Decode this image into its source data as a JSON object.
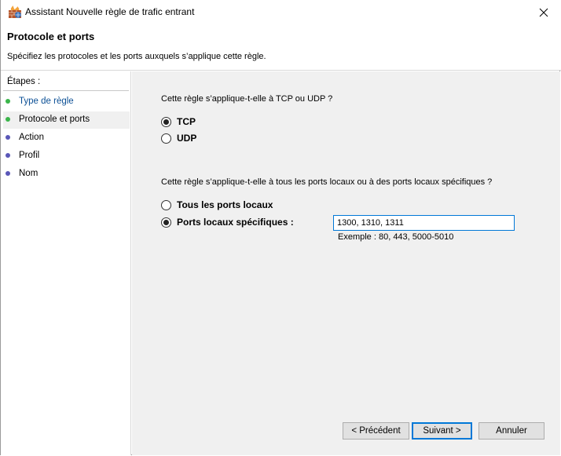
{
  "window": {
    "title": "Assistant Nouvelle règle de trafic entrant",
    "icon": "firewall-icon"
  },
  "header": {
    "title": "Protocole et ports",
    "description": "Spécifiez les protocoles et les ports auxquels s’applique cette règle."
  },
  "sidebar": {
    "steps_label": "Étapes :",
    "steps": [
      {
        "label": "Type de règle",
        "state": "done",
        "color": "#3ab54a",
        "text_color": "#0b4f95"
      },
      {
        "label": "Protocole et ports",
        "state": "current",
        "color": "#3ab54a",
        "text_color": "#000000"
      },
      {
        "label": "Action",
        "state": "pending",
        "color": "#5a57b8",
        "text_color": "#000000"
      },
      {
        "label": "Profil",
        "state": "pending",
        "color": "#5a57b8",
        "text_color": "#000000"
      },
      {
        "label": "Nom",
        "state": "pending",
        "color": "#5a57b8",
        "text_color": "#000000"
      }
    ]
  },
  "main": {
    "protocol_question": "Cette règle s’applique-t-elle à TCP ou UDP ?",
    "protocol_options": [
      {
        "label": "TCP",
        "selected": true
      },
      {
        "label": "UDP",
        "selected": false
      }
    ],
    "ports_question": "Cette règle s’applique-t-elle à tous les ports locaux ou à des ports locaux spécifiques ?",
    "ports_options": [
      {
        "label": "Tous les ports locaux",
        "selected": false
      },
      {
        "label": "Ports locaux spécifiques :",
        "selected": true
      }
    ],
    "ports_value": "1300, 1310, 1311",
    "example": "Exemple : 80, 443, 5000-5010"
  },
  "buttons": {
    "back": "< Précédent",
    "next": "Suivant >",
    "cancel": "Annuler"
  },
  "colors": {
    "accent": "#0078d7",
    "content_bg": "#f0f0f0"
  }
}
